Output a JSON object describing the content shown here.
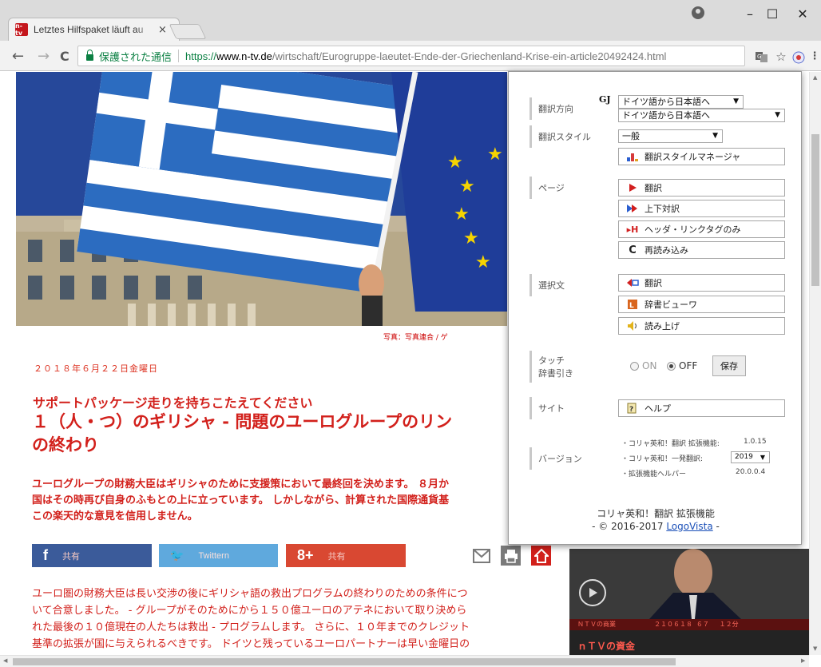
{
  "browser": {
    "tab_title": "Letztes Hilfspaket läuft au",
    "tab_favicon": "n-tv",
    "tab_close": "×",
    "window_controls": {
      "minimize": "–",
      "maximize": "☐",
      "close": "✕"
    },
    "nav": {
      "back": "←",
      "forward": "→",
      "reload": "C"
    },
    "address": {
      "secure_label": "保護された通信",
      "scheme": "https://",
      "host": "www.n-tv.de",
      "path": "/wirtschaft/Eurogruppe-laeutet-Ende-der-Griechenland-Krise-ein-article20492424.html"
    },
    "icons": [
      "translate-icon",
      "star-icon",
      "extension-icon",
      "menu-icon"
    ]
  },
  "article": {
    "photo_caption": "写真：写真連合 / ゲ",
    "date": "２０１８年６月２２日金曜日",
    "kicker": "サポートパッケージ走りを持ちこたえてください",
    "headline_line1": "１（人・つ）のギリシャ - 問題のユーログループのリン",
    "headline_line2": "の終わり",
    "lead_line1": "ユーログループの財務大臣はギリシャのために支援策において最終回を決めます。 ８月か",
    "lead_line2": "国はその時再び自身のふもとの上に立っています。 しかしながら、計算された国際通貨基",
    "lead_line3": "この楽天的な意見を信用しません。",
    "share": {
      "facebook_glyph": "f",
      "facebook_label": "共有",
      "twitter_glyph": "🐦",
      "twitter_label": "Twittern",
      "gplus_glyph": "8+",
      "gplus_label": "共有"
    },
    "body_line1": "ユーロ圏の財務大臣は長い交渉の後にギリシャ語の救出プログラムの終わりのための条件につ",
    "body_line2": "いて合意しました。 - グループがそのためにから１５０億ユーロのアテネにおいて取り決めら",
    "body_line3": "れた最後の１０億現在の人たちは救出 - プログラムします。 さらに、１０年までのクレジット",
    "body_line4": "基準の拡張が国に与えられるべきです。 ドイツと残っているユーロパートナーは早い金曜日の",
    "video": {
      "ticker": "ＮＴＶの商業　　　　　　２１０６１８ ６７ 　１２分",
      "title": "ｎＴＶの資金"
    }
  },
  "popup": {
    "logo": "GJ",
    "direction_label": "翻訳方向",
    "direction_value": "ドイツ語から日本語へ",
    "direction_option": "ドイツ語から日本語へ",
    "style_label": "翻訳スタイル",
    "style_value": "一般",
    "style_manager_button": "翻訳スタイルマネージャ",
    "page_label": "ページ",
    "page_buttons": [
      "翻訳",
      "上下対訳",
      "ヘッダ・リンクタグのみ",
      "再読み込み"
    ],
    "selection_label": "選択文",
    "selection_buttons": [
      "翻訳",
      "辞書ビューワ",
      "読み上げ"
    ],
    "touch_label_1": "タッチ",
    "touch_label_2": "辞書引き",
    "on_label": "ON",
    "off_label": "OFF",
    "touch_selected": "OFF",
    "save_button": "保存",
    "site_label": "サイト",
    "help_button": "ヘルプ",
    "version_label": "バージョン",
    "versions": [
      {
        "name": "・コリャ英和！翻訳 拡張機能:",
        "value": "1.0.15"
      },
      {
        "name": "・コリャ英和！一発翻訳:",
        "value": "2019"
      },
      {
        "name": "・拡張機能ヘルパー",
        "value": "20.0.0.4"
      }
    ],
    "footer_line1": "コリャ英和！翻訳 拡張機能",
    "footer_prefix": "- © 2016-2017 ",
    "footer_link": "LogoVista",
    "footer_suffix": " -"
  }
}
